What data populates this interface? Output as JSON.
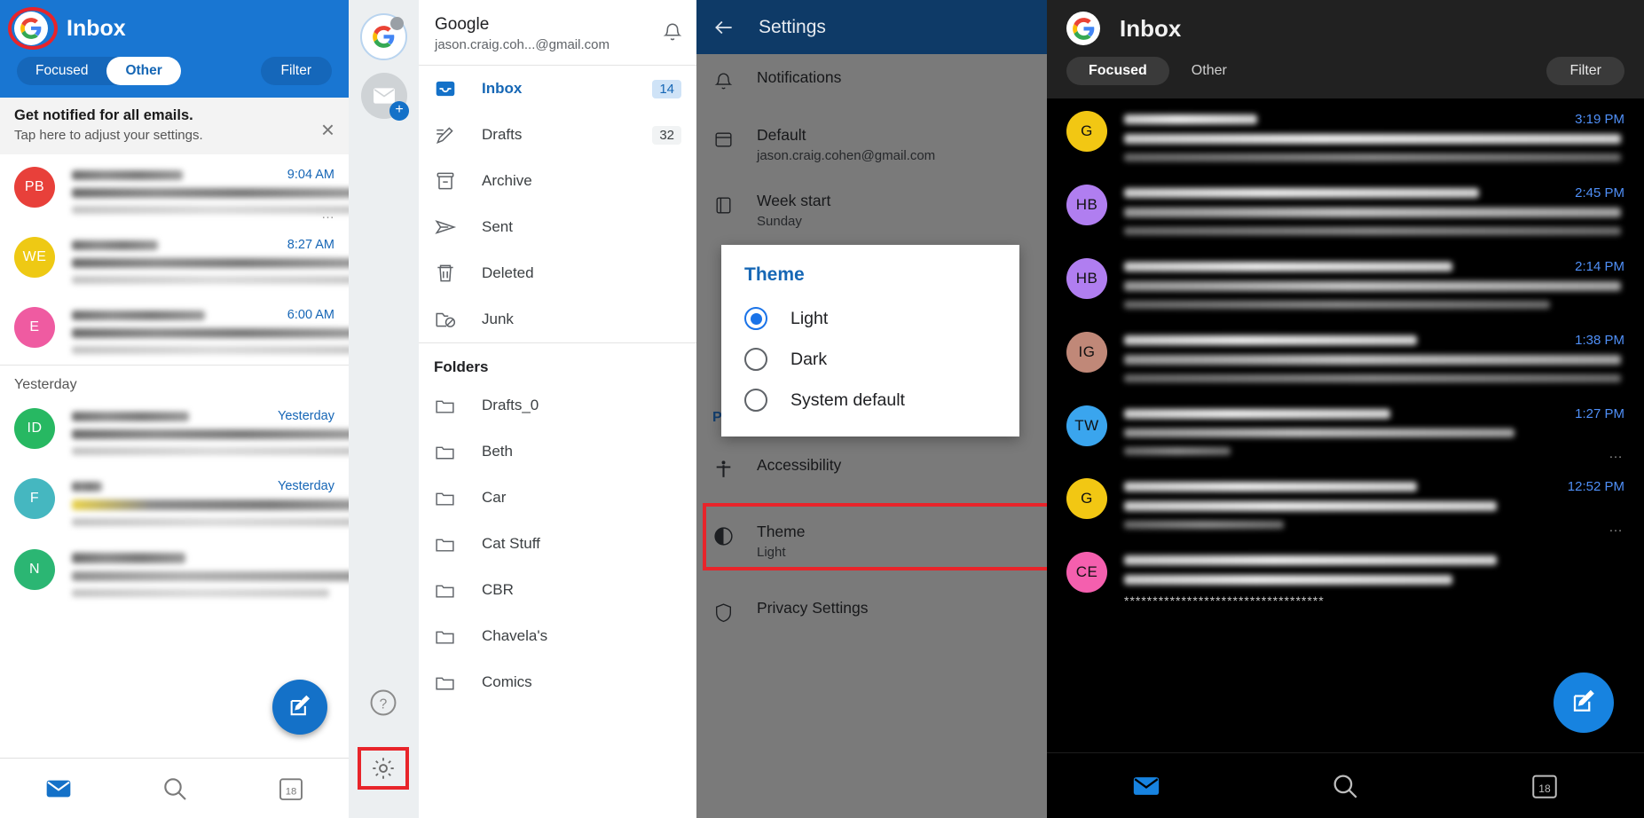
{
  "panel1": {
    "name": "light-inbox",
    "appbar": {
      "title": "Inbox",
      "focused": "Focused",
      "other": "Other",
      "filter": "Filter"
    },
    "banner": {
      "headline": "Get notified for all emails.",
      "sub": "Tap here to adjust your settings.",
      "close": "×"
    },
    "today_rows": [
      {
        "initials": "PB",
        "color": "#e8403a",
        "time": "9:04 AM"
      },
      {
        "initials": "WE",
        "color": "#eec914",
        "time": "8:27 AM"
      },
      {
        "initials": "E",
        "color": "#ef5ba1",
        "time": "6:00 AM"
      }
    ],
    "section_label": "Yesterday",
    "yesterday_rows": [
      {
        "initials": "ID",
        "color": "#27b862",
        "time": "Yesterday"
      },
      {
        "initials": "F",
        "color": "#45b7c0",
        "time": "Yesterday"
      },
      {
        "initials": "N",
        "color": "#2bb673",
        "time": ""
      }
    ],
    "bottom_nav": [
      "mail-icon",
      "search-icon",
      "calendar-18-icon"
    ],
    "compose": "compose-icon"
  },
  "panel2": {
    "name": "navigation-drawer",
    "account": {
      "name": "Google",
      "email": "jason.craig.coh...@gmail.com"
    },
    "bell": "bell-icon",
    "system_folders": [
      {
        "label": "Inbox",
        "icon": "inbox-icon",
        "badge": "14",
        "selected": true
      },
      {
        "label": "Drafts",
        "icon": "drafts-icon",
        "badge": "32",
        "selected": false
      },
      {
        "label": "Archive",
        "icon": "archive-icon",
        "badge": "",
        "selected": false
      },
      {
        "label": "Sent",
        "icon": "sent-icon",
        "badge": "",
        "selected": false
      },
      {
        "label": "Deleted",
        "icon": "trash-icon",
        "badge": "",
        "selected": false
      },
      {
        "label": "Junk",
        "icon": "junk-icon",
        "badge": "",
        "selected": false
      }
    ],
    "folders_header": "Folders",
    "folders": [
      "Drafts_0",
      "Beth",
      "Car",
      "Cat Stuff",
      "CBR",
      "Chavela's",
      "Comics"
    ],
    "rail": {
      "help": "help-icon",
      "settings": "gear-icon",
      "add_account": "add-account-icon"
    }
  },
  "panel3": {
    "name": "settings-screen",
    "appbar": {
      "back": "back-arrow-icon",
      "title": "Settings"
    },
    "items": [
      {
        "title": "Notifications",
        "sub": "",
        "icon": "bell-icon"
      },
      {
        "title": "Default",
        "sub": "jason.craig.cohen@gmail.com",
        "icon": "mailbox-icon"
      },
      {
        "title": "Week start",
        "sub": "Sunday",
        "icon": "calendar-icon"
      },
      {
        "title": "Accessibility",
        "sub": "",
        "icon": "accessibility-icon"
      },
      {
        "title": "Theme",
        "sub": "Light",
        "icon": "theme-contrast-icon",
        "highlighted": true
      },
      {
        "title": "Privacy Settings",
        "sub": "",
        "icon": "shield-icon"
      }
    ],
    "section_preferences": "Preferences",
    "dialog": {
      "title": "Theme",
      "options": [
        {
          "label": "Light",
          "selected": true
        },
        {
          "label": "Dark",
          "selected": false
        },
        {
          "label": "System default",
          "selected": false
        }
      ]
    }
  },
  "panel4": {
    "name": "dark-inbox",
    "appbar": {
      "title": "Inbox",
      "focused": "Focused",
      "other": "Other",
      "filter": "Filter"
    },
    "rows": [
      {
        "initials": "G",
        "color": "#f2c713",
        "time": "3:19 PM",
        "dots": false,
        "stars": ""
      },
      {
        "initials": "HB",
        "color": "#b07ef0",
        "time": "2:45 PM",
        "dots": false,
        "stars": ""
      },
      {
        "initials": "HB",
        "color": "#b07ef0",
        "time": "2:14 PM",
        "dots": false,
        "stars": ""
      },
      {
        "initials": "IG",
        "color": "#c08878",
        "time": "1:38 PM",
        "dots": false,
        "stars": ""
      },
      {
        "initials": "TW",
        "color": "#3aa5ee",
        "time": "1:27 PM",
        "dots": true,
        "stars": ""
      },
      {
        "initials": "G",
        "color": "#f2c713",
        "time": "12:52 PM",
        "dots": true,
        "stars": ""
      },
      {
        "initials": "CE",
        "color": "#f45fae",
        "time": "",
        "dots": false,
        "stars": "***********************************"
      }
    ],
    "bottom_nav": [
      "mail-icon",
      "search-icon",
      "calendar-18-icon"
    ],
    "compose": "compose-icon"
  },
  "colors": {
    "brand_blue": "#1976d2",
    "dark_blue": "#0e3a67",
    "accent_link": "#1667b5",
    "highlight_red": "#e8242a",
    "dark_bg": "#000000"
  }
}
